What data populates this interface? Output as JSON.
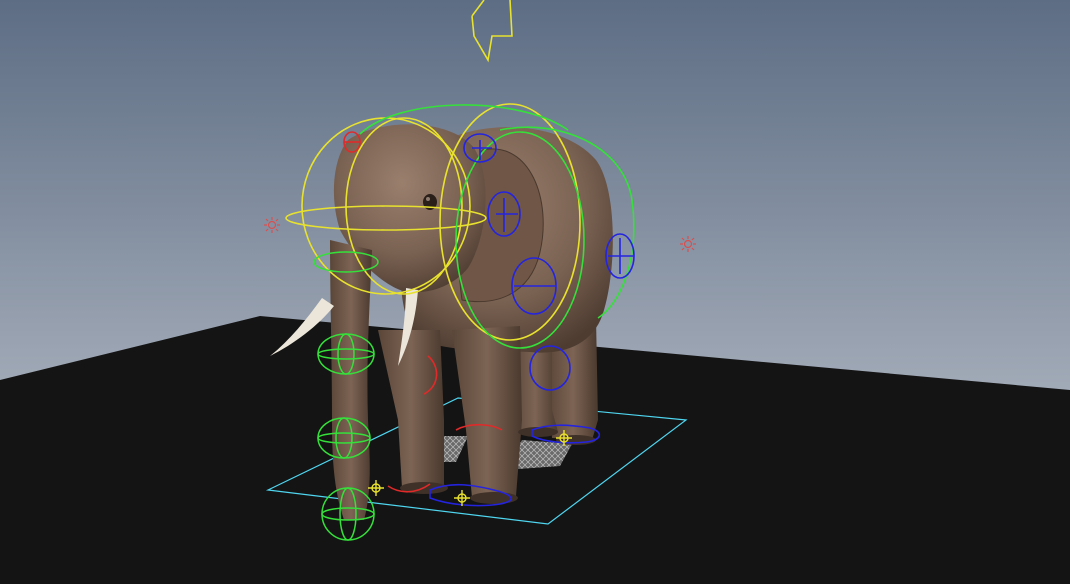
{
  "viewport": {
    "panel": "3D viewport",
    "subject": "elephant-rig",
    "colors": {
      "sky_top": "#5d6d84",
      "sky_bottom": "#c3c8d0",
      "ground": "#141414",
      "elephant_skin": "#7a6252",
      "tusk": "#ece6da",
      "grid_outline": "#4fd6f0",
      "ctrl_green": "#35e03a",
      "ctrl_yellow": "#e8e22e",
      "ctrl_blue": "#2424e0",
      "ctrl_red": "#e02a2a",
      "light_icon": "#d85050"
    },
    "controls": [
      "camera-arrow-control",
      "head-controls",
      "spine-controls",
      "trunk-controls",
      "leg-ik-controls",
      "foot-pivot-controls",
      "light-icons"
    ]
  }
}
